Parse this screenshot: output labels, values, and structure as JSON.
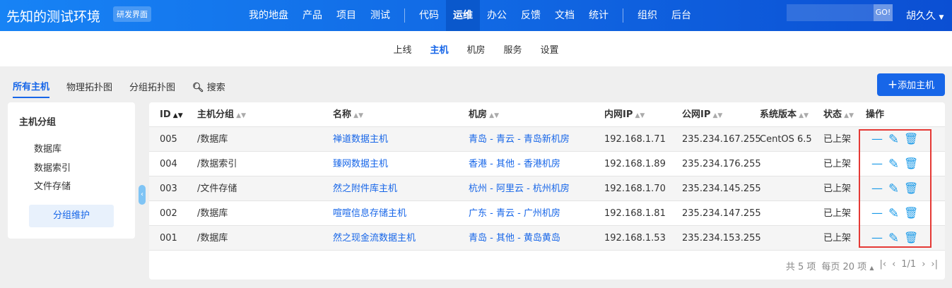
{
  "header": {
    "title": "先知的测试环境",
    "badge": "研发界面",
    "nav": [
      "我的地盘",
      "产品",
      "项目",
      "测试",
      "代码",
      "运维",
      "办公",
      "反馈",
      "文档",
      "统计",
      "组织",
      "后台"
    ],
    "active": "运维",
    "go": "GO!",
    "user": "胡久久"
  },
  "subnav": {
    "items": [
      "上线",
      "主机",
      "机房",
      "服务",
      "设置"
    ],
    "active": "主机"
  },
  "tabs": {
    "items": [
      "所有主机",
      "物理拓扑图",
      "分组拓扑图"
    ],
    "search": "搜索",
    "add": "添加主机"
  },
  "sidebar": {
    "title": "主机分组",
    "items": [
      "数据库",
      "数据索引",
      "文件存储"
    ],
    "maintain": "分组维护"
  },
  "table": {
    "headers": [
      "ID",
      "主机分组",
      "名称",
      "机房",
      "内网IP",
      "公网IP",
      "系统版本",
      "状态",
      "操作"
    ],
    "rows": [
      [
        "005",
        "/数据库",
        "禅道数据主机",
        "青岛 - 青云 - 青岛新机房",
        "192.168.1.71",
        "235.234.167.255",
        "CentOS 6.5",
        "已上架"
      ],
      [
        "004",
        "/数据索引",
        "臻网数据主机",
        "香港 - 其他 - 香港机房",
        "192.168.1.89",
        "235.234.176.255",
        "",
        "已上架"
      ],
      [
        "003",
        "/文件存储",
        "然之附件库主机",
        "杭州 - 阿里云 - 杭州机房",
        "192.168.1.70",
        "235.234.145.255",
        "",
        "已上架"
      ],
      [
        "002",
        "/数据库",
        "喧喧信息存储主机",
        "广东 - 青云 - 广州机房",
        "192.168.1.81",
        "235.234.147.255",
        "",
        "已上架"
      ],
      [
        "001",
        "/数据库",
        "然之现金流数据主机",
        "青岛 - 其他 - 黄岛黄岛",
        "192.168.1.53",
        "235.234.153.255",
        "",
        "已上架"
      ]
    ]
  },
  "pager": {
    "total": "共 5 项",
    "per_page": "每页 20 项",
    "page": "1/1"
  }
}
